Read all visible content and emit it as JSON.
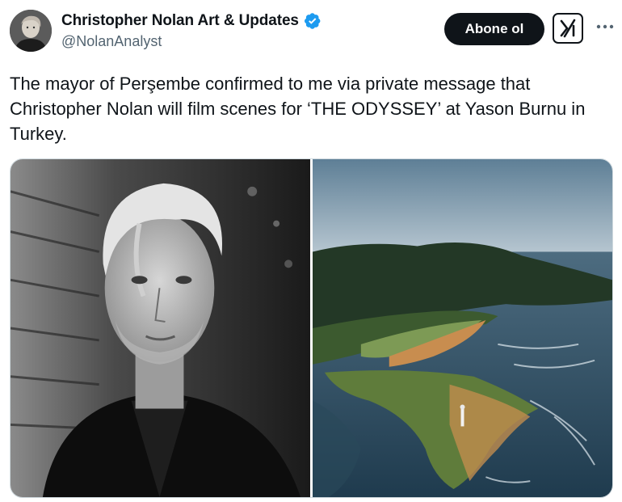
{
  "author": {
    "display_name": "Christopher Nolan Art & Updates",
    "handle": "@NolanAnalyst",
    "verified": true,
    "avatar_icon": "profile-photo"
  },
  "actions": {
    "subscribe_label": "Abone ol",
    "grok_icon": "grok-icon",
    "more_icon": "more-icon"
  },
  "tweet": {
    "text": "The mayor of Perşembe confirmed to me via private message that Christopher Nolan will film scenes for ‘THE ODYSSEY’ at Yason Burnu in Turkey."
  },
  "media": [
    {
      "description_icon": "portrait-photo"
    },
    {
      "description_icon": "aerial-landscape-photo"
    }
  ],
  "colors": {
    "verified": "#1d9bf0",
    "text": "#0f1419",
    "secondary": "#536471",
    "button_bg": "#0f1419"
  }
}
